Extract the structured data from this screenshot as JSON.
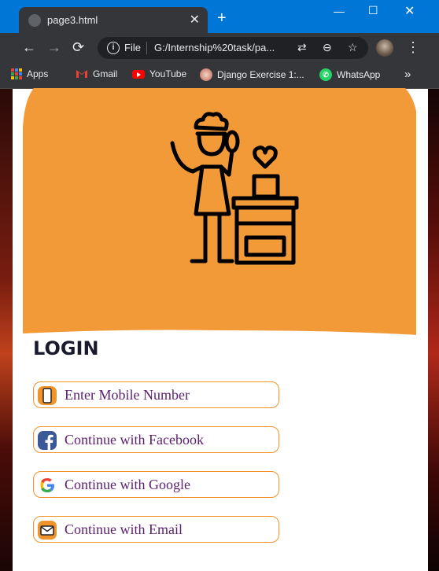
{
  "browser": {
    "tab_title": "page3.html",
    "omnibox_scheme": "File",
    "omnibox_url": "G:/Internship%20task/pa...",
    "bookmarks": [
      {
        "label": "Apps",
        "icon": "apps-grid-icon"
      },
      {
        "label": "Gmail",
        "icon": "gmail-icon"
      },
      {
        "label": "YouTube",
        "icon": "youtube-icon"
      },
      {
        "label": "Django Exercise 1:...",
        "icon": "django-avatar-icon"
      },
      {
        "label": "WhatsApp",
        "icon": "whatsapp-icon"
      }
    ],
    "more_bookmarks": "»"
  },
  "page": {
    "login_title": "LOGIN",
    "options": [
      {
        "label": "Enter Mobile Number",
        "icon": "mobile-phone-icon"
      },
      {
        "label": "Continue with Facebook",
        "icon": "facebook-icon"
      },
      {
        "label": "Continue with Google",
        "icon": "google-icon"
      },
      {
        "label": "Continue with Email",
        "icon": "email-icon"
      }
    ]
  },
  "colors": {
    "titlebar": "#0077d6",
    "toolbar": "#35363a",
    "hero_orange": "#f39a38",
    "option_border": "#f0932b",
    "option_text": "#5b1f6e",
    "title_text": "#1a1a2e"
  }
}
